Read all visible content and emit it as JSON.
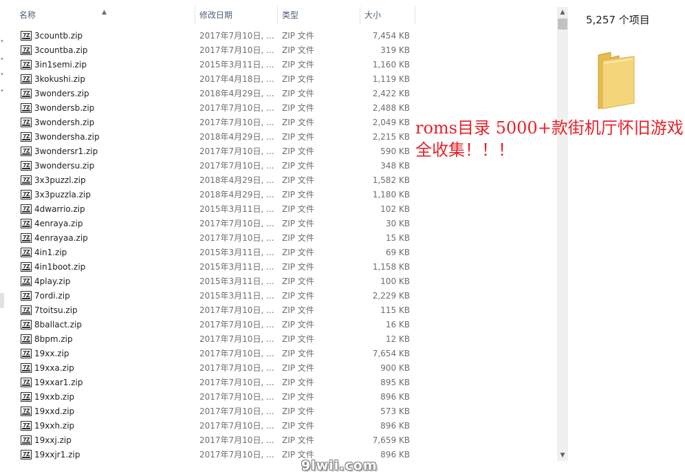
{
  "columns": {
    "name": "名称",
    "date": "修改日期",
    "type": "类型",
    "size": "大小"
  },
  "files": [
    {
      "name": "3countb.zip",
      "date": "2017年7月10日, ...",
      "type": "ZIP 文件",
      "size": "7,454 KB"
    },
    {
      "name": "3countba.zip",
      "date": "2017年7月10日, ...",
      "type": "ZIP 文件",
      "size": "319 KB"
    },
    {
      "name": "3in1semi.zip",
      "date": "2015年3月11日, ...",
      "type": "ZIP 文件",
      "size": "1,160 KB"
    },
    {
      "name": "3kokushi.zip",
      "date": "2017年4月18日, ...",
      "type": "ZIP 文件",
      "size": "1,119 KB"
    },
    {
      "name": "3wonders.zip",
      "date": "2018年4月29日, ...",
      "type": "ZIP 文件",
      "size": "2,422 KB"
    },
    {
      "name": "3wondersb.zip",
      "date": "2017年7月10日, ...",
      "type": "ZIP 文件",
      "size": "2,488 KB"
    },
    {
      "name": "3wondersh.zip",
      "date": "2017年7月10日, ...",
      "type": "ZIP 文件",
      "size": "2,049 KB"
    },
    {
      "name": "3wondersha.zip",
      "date": "2018年4月29日, ...",
      "type": "ZIP 文件",
      "size": "2,215 KB"
    },
    {
      "name": "3wondersr1.zip",
      "date": "2017年7月10日, ...",
      "type": "ZIP 文件",
      "size": "590 KB"
    },
    {
      "name": "3wondersu.zip",
      "date": "2017年7月10日, ...",
      "type": "ZIP 文件",
      "size": "348 KB"
    },
    {
      "name": "3x3puzzl.zip",
      "date": "2018年4月29日, ...",
      "type": "ZIP 文件",
      "size": "1,582 KB"
    },
    {
      "name": "3x3puzzla.zip",
      "date": "2018年4月29日, ...",
      "type": "ZIP 文件",
      "size": "1,180 KB"
    },
    {
      "name": "4dwarrio.zip",
      "date": "2015年3月11日, ...",
      "type": "ZIP 文件",
      "size": "102 KB"
    },
    {
      "name": "4enraya.zip",
      "date": "2017年7月10日, ...",
      "type": "ZIP 文件",
      "size": "30 KB"
    },
    {
      "name": "4enrayaa.zip",
      "date": "2017年7月10日, ...",
      "type": "ZIP 文件",
      "size": "15 KB"
    },
    {
      "name": "4in1.zip",
      "date": "2015年3月11日, ...",
      "type": "ZIP 文件",
      "size": "69 KB"
    },
    {
      "name": "4in1boot.zip",
      "date": "2015年3月11日, ...",
      "type": "ZIP 文件",
      "size": "1,158 KB"
    },
    {
      "name": "4play.zip",
      "date": "2015年3月11日, ...",
      "type": "ZIP 文件",
      "size": "100 KB"
    },
    {
      "name": "7ordi.zip",
      "date": "2015年3月11日, ...",
      "type": "ZIP 文件",
      "size": "2,229 KB"
    },
    {
      "name": "7toitsu.zip",
      "date": "2017年7月10日, ...",
      "type": "ZIP 文件",
      "size": "115 KB"
    },
    {
      "name": "8ballact.zip",
      "date": "2017年7月10日, ...",
      "type": "ZIP 文件",
      "size": "16 KB"
    },
    {
      "name": "8bpm.zip",
      "date": "2017年7月10日, ...",
      "type": "ZIP 文件",
      "size": "12 KB"
    },
    {
      "name": "19xx.zip",
      "date": "2017年7月10日, ...",
      "type": "ZIP 文件",
      "size": "7,654 KB"
    },
    {
      "name": "19xxa.zip",
      "date": "2017年7月10日, ...",
      "type": "ZIP 文件",
      "size": "900 KB"
    },
    {
      "name": "19xxar1.zip",
      "date": "2017年7月10日, ...",
      "type": "ZIP 文件",
      "size": "895 KB"
    },
    {
      "name": "19xxb.zip",
      "date": "2017年7月10日, ...",
      "type": "ZIP 文件",
      "size": "896 KB"
    },
    {
      "name": "19xxd.zip",
      "date": "2017年7月10日, ...",
      "type": "ZIP 文件",
      "size": "573 KB"
    },
    {
      "name": "19xxh.zip",
      "date": "2017年7月10日, ...",
      "type": "ZIP 文件",
      "size": "896 KB"
    },
    {
      "name": "19xxj.zip",
      "date": "2017年7月10日, ...",
      "type": "ZIP 文件",
      "size": "7,659 KB"
    },
    {
      "name": "19xxjr1.zip",
      "date": "2017年7月10日, ...",
      "type": "ZIP 文件",
      "size": "896 KB"
    }
  ],
  "file_icon_label": "7Z",
  "details_pane": {
    "item_count": "5,257 个项目"
  },
  "promo_text": "roms目录 5000+款街机厅怀旧游戏全收集！！！",
  "watermark": "9lwii.com",
  "icons": {
    "file": "7zip-archive-icon",
    "folder": "folder-icon",
    "sort": "sort-up-arrow-icon",
    "scroll_up": "scroll-up-arrow-icon",
    "scroll_down": "scroll-down-arrow-icon",
    "pin": "pin-icon"
  },
  "colors": {
    "folder_main": "#f5d57a",
    "folder_back": "#e7bb4f",
    "promo": "#e8212a",
    "header_text": "#4c607a",
    "secondary_text": "#6d6d6d"
  }
}
